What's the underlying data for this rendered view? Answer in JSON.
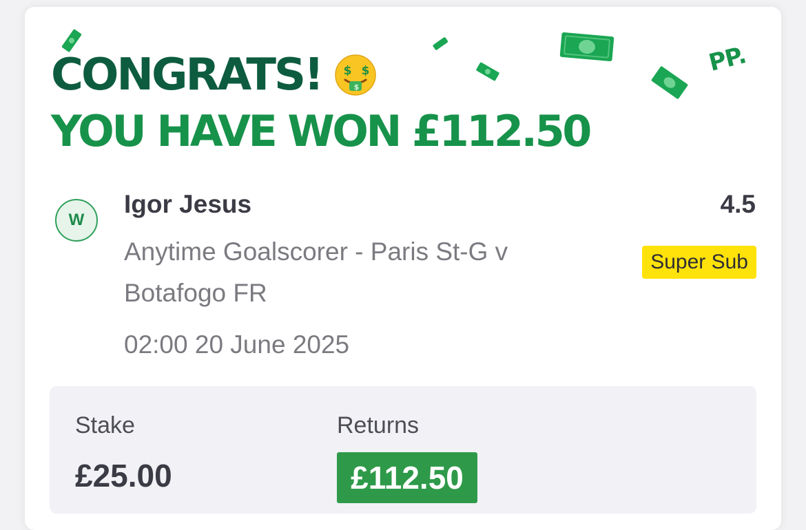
{
  "header": {
    "congrats": "CONGRATS!",
    "won_text": "YOU HAVE WON £112.50",
    "brand_mark": "PP."
  },
  "icons": {
    "face": "money-mouth-face-icon",
    "cash": "banknote-icon"
  },
  "bet": {
    "result_badge": "W",
    "selection": "Igor Jesus",
    "market": "Anytime Goalscorer - Paris St-G v Botafogo FR",
    "datetime": "02:00 20 June 2025",
    "odds": "4.5",
    "tag": "Super Sub"
  },
  "summary": {
    "stake_label": "Stake",
    "stake_value": "£25.00",
    "returns_label": "Returns",
    "returns_value": "£112.50"
  },
  "colors": {
    "dark_green": "#0d5c40",
    "bright_green": "#17924a",
    "returns_green": "#2e9a49",
    "super_sub_yellow": "#ffe20a"
  }
}
